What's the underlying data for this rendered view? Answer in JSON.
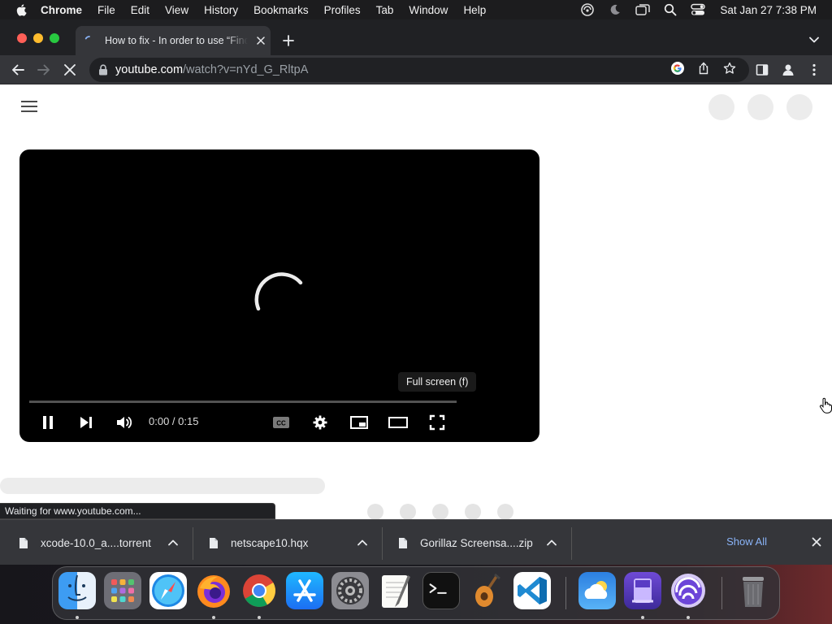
{
  "menubar": {
    "app_name": "Chrome",
    "items": [
      "File",
      "Edit",
      "View",
      "History",
      "Bookmarks",
      "Profiles",
      "Tab",
      "Window",
      "Help"
    ],
    "status_icons": [
      "extension-status-icon",
      "moon-icon",
      "screen-mirroring-icon",
      "spotlight-search-icon",
      "control-center-icon"
    ],
    "clock": "Sat Jan 27  7:38 PM"
  },
  "browser": {
    "tab_title": "How to fix - In order to use “Find My”",
    "url_host": "youtube.com",
    "url_path": "/watch?v=nYd_G_RltpA",
    "status_text": "Waiting for www.youtube.com..."
  },
  "player": {
    "time": "0:00 / 0:15",
    "tooltip": "Full screen (f)",
    "progress": 0
  },
  "downloads": {
    "items": [
      {
        "name": "xcode-10.0_a....torrent"
      },
      {
        "name": "netscape10.hqx"
      },
      {
        "name": "Gorillaz Screensa....zip"
      }
    ],
    "show_all_label": "Show All"
  },
  "dock": {
    "apps": [
      "finder",
      "launchpad",
      "safari",
      "firefox",
      "chrome",
      "app-store",
      "system-settings",
      "textedit",
      "terminal",
      "garageband",
      "vscode",
      "weather",
      "ipod-style-app",
      "bittorrent",
      "trash"
    ],
    "running": [
      "finder",
      "firefox",
      "chrome",
      "ipod-style-app",
      "bittorrent"
    ]
  },
  "colors": {
    "accent": "#8ab4f8",
    "close": "#ff5f57",
    "minimize": "#febc2e",
    "zoom": "#28c840"
  }
}
